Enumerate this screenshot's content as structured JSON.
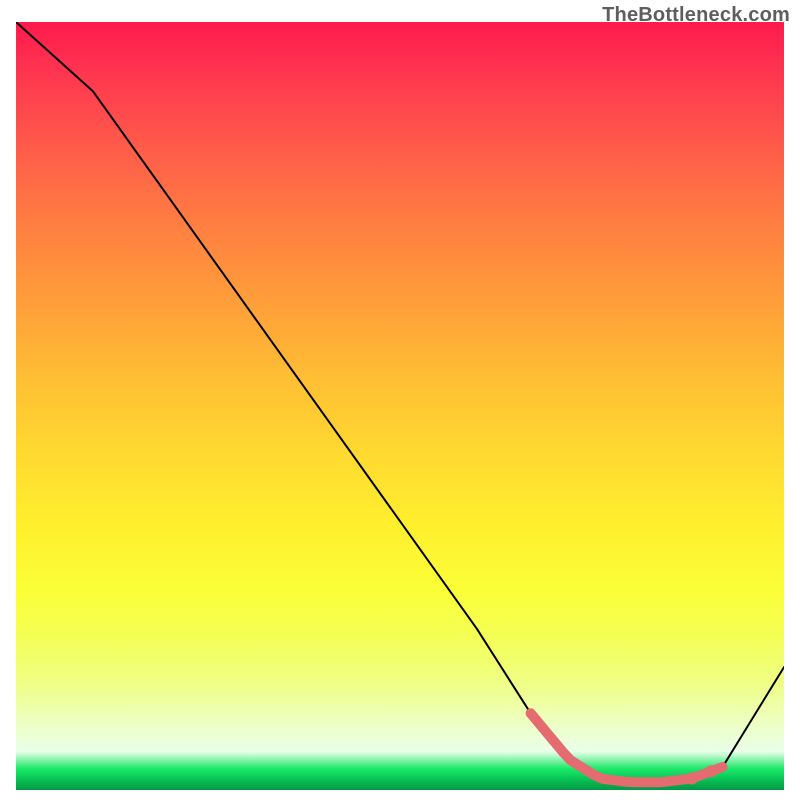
{
  "attribution": "TheBottleneck.com",
  "colors": {
    "gradient_top": "#ff1a4c",
    "gradient_mid": "#ffd930",
    "gradient_low": "#fbff38",
    "gradient_green": "#0fd65e",
    "curve": "#000000",
    "marker": "#e46b70"
  },
  "chart_data": {
    "type": "line",
    "title": "",
    "xlabel": "",
    "ylabel": "",
    "xlim": [
      0,
      100
    ],
    "ylim": [
      0,
      100
    ],
    "grid": false,
    "series": [
      {
        "name": "bottleneck-curve",
        "x": [
          0,
          10,
          20,
          30,
          40,
          50,
          60,
          67,
          72,
          76,
          80,
          84,
          88,
          92,
          100
        ],
        "y": [
          100,
          91,
          77,
          63,
          49,
          35,
          21,
          10,
          4,
          1.5,
          1,
          1,
          1.5,
          3,
          16
        ]
      }
    ],
    "highlight_range_x": [
      67,
      92
    ],
    "highlight_dots_x": [
      88,
      90.5
    ]
  }
}
